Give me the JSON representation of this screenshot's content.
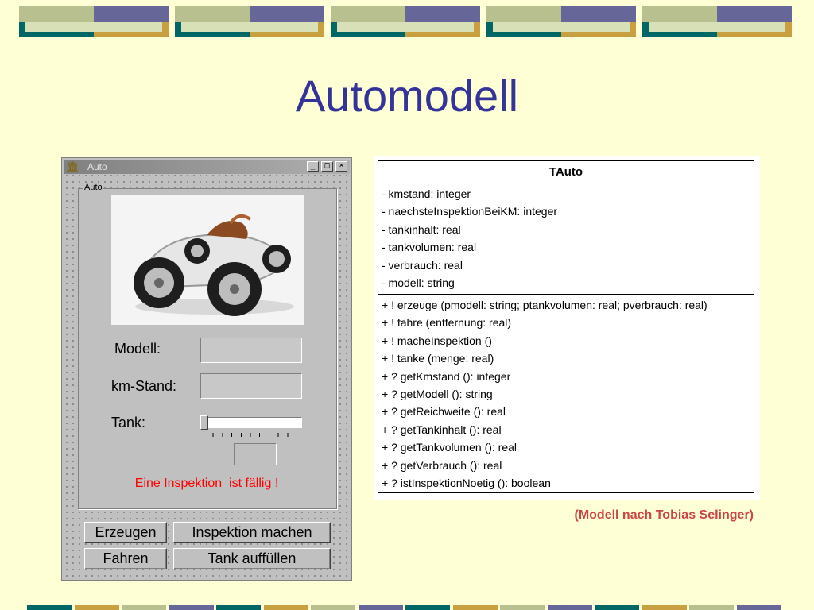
{
  "slide": {
    "title": "Automodell",
    "credit": "(Modell nach Tobias Selinger)"
  },
  "colors": {
    "background": "#ffffd6",
    "title": "#333399",
    "decor_teal": "#006666",
    "decor_purple": "#666699",
    "decor_gold": "#c8a040",
    "decor_sage": "#b8c090",
    "warning": "#ff0000",
    "credit": "#cc4444"
  },
  "window": {
    "title": "Auto",
    "icon": "house-icon",
    "controls": {
      "minimize": "_",
      "maximize": "□",
      "close": "×"
    },
    "group_label": "Auto",
    "image": "race-car-image",
    "labels": {
      "model": "Modell:",
      "km": "km-Stand:",
      "tank": "Tank:"
    },
    "fields": {
      "model_value": "",
      "km_value": "",
      "tank_value": ""
    },
    "tank_level": 0,
    "warning": "Eine Inspektion  ist fällig !",
    "buttons": {
      "create": "Erzeugen",
      "inspect": "Inspektion machen",
      "drive": "Fahren",
      "refuel": "Tank auffüllen"
    }
  },
  "uml": {
    "class_name": "TAuto",
    "attributes": [
      "- kmstand: integer",
      "- naechsteInspektionBeiKM: integer",
      "- tankinhalt: real",
      "- tankvolumen: real",
      "- verbrauch: real",
      "- modell: string"
    ],
    "methods": [
      "+ ! erzeuge (pmodell: string; ptankvolumen: real; pverbrauch: real)",
      "+ ! fahre (entfernung: real)",
      "+ ! macheInspektion ()",
      "+ ! tanke (menge: real)",
      "+ ? getKmstand (): integer",
      "+ ? getModell (): string",
      "+ ? getReichweite (): real",
      "+ ? getTankinhalt (): real",
      "+ ? getTankvolumen (): real",
      "+ ? getVerbrauch (): real",
      "+ ? istInspektionNoetig (): boolean"
    ]
  }
}
